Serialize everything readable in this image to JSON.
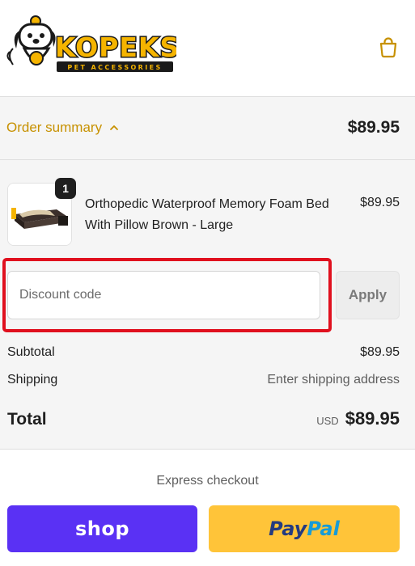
{
  "brand": {
    "name": "KOPEKS",
    "tagline": "PET ACCESSORIES",
    "accent_color": "#f5b400"
  },
  "header": {
    "cart_icon": "shopping-bag-icon"
  },
  "order_summary": {
    "toggle_label": "Order summary",
    "toggle_icon": "chevron-up-icon",
    "total": "$89.95",
    "toggle_color": "#c79100"
  },
  "line_items": [
    {
      "quantity": "1",
      "name": "Orthopedic Waterproof Memory Foam Bed With Pillow Brown - Large",
      "price": "$89.95"
    }
  ],
  "discount": {
    "placeholder": "Discount code",
    "apply_label": "Apply",
    "highlight_color": "#e0101e"
  },
  "totals": {
    "subtotal_label": "Subtotal",
    "subtotal_value": "$89.95",
    "shipping_label": "Shipping",
    "shipping_value": "Enter shipping address",
    "total_label": "Total",
    "currency": "USD",
    "total_value": "$89.95"
  },
  "express_checkout": {
    "title": "Express checkout",
    "shop_label": "shop",
    "shop_color": "#5a31f4",
    "paypal_label_1": "Pay",
    "paypal_label_2": "Pal",
    "paypal_color": "#ffc439"
  }
}
